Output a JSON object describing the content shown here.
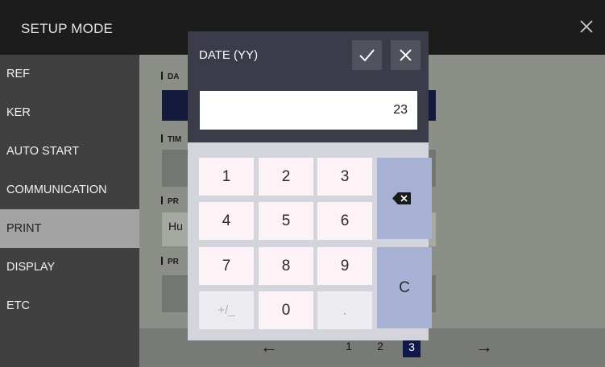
{
  "app": {
    "title": "SETUP MODE"
  },
  "sidebar": {
    "items": [
      {
        "label": "REF"
      },
      {
        "label": "KER"
      },
      {
        "label": "AUTO START"
      },
      {
        "label": "COMMUNICATION"
      },
      {
        "label": "PRINT"
      },
      {
        "label": "DISPLAY"
      },
      {
        "label": "ETC"
      }
    ],
    "active": "PRINT"
  },
  "main": {
    "sections": [
      {
        "label": "DA"
      },
      {
        "label": "TIM"
      },
      {
        "label": "PR",
        "value": "Hu"
      },
      {
        "label": "PR"
      }
    ]
  },
  "pagination": {
    "prev_icon": "arrow-left-icon",
    "next_icon": "arrow-right-icon",
    "pages": [
      "1",
      "2",
      "3"
    ],
    "current": "3",
    "prev_glyph": "←",
    "next_glyph": "→"
  },
  "dialog": {
    "title": "DATE (YY)",
    "value": "23",
    "confirm_icon": "check-icon",
    "close_icon": "close-icon",
    "keys": {
      "k1": "1",
      "k2": "2",
      "k3": "3",
      "k4": "4",
      "k5": "5",
      "k6": "6",
      "k7": "7",
      "k8": "8",
      "k9": "9",
      "sign": "+/_",
      "k0": "0",
      "dot": ".",
      "clear": "C",
      "backspace_icon": "backspace-icon"
    }
  },
  "colors": {
    "dialog_header": "#3a3c4a",
    "key_face": "#fdf3f7",
    "side_key": "#a6b1d3",
    "page_current_bg": "#11194a"
  }
}
